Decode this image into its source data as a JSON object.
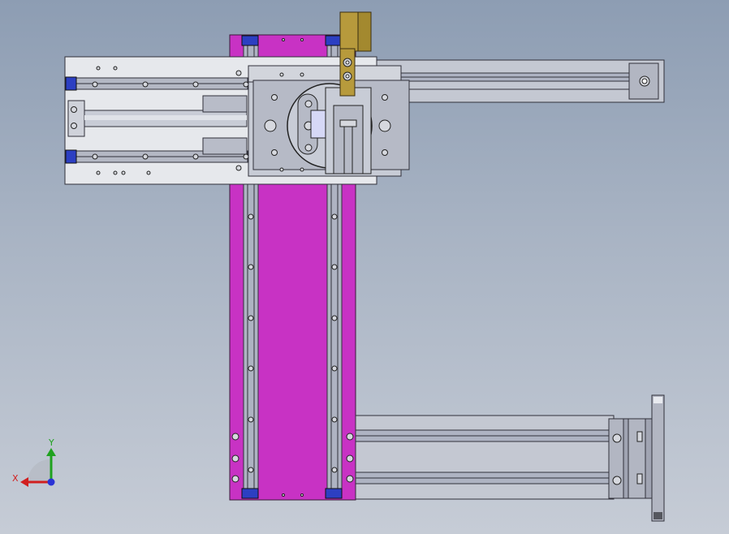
{
  "viewport": {
    "kind": "cad-graphics-area",
    "model": "gantry-slide-assembly",
    "view": "front"
  },
  "colors": {
    "background_top": "#8d9db3",
    "background_bottom": "#c6ccd6",
    "magenta_plate": "#c832c4",
    "rail_grey": "#9ea3b3",
    "frame_light": "#e6e8ec",
    "brass_bar": "#b79a3c",
    "mount_blue": "#2c3fc2",
    "axis_x": "#d11f1f",
    "axis_y": "#1fa21f",
    "axis_z": "#2a33d6"
  },
  "triad": {
    "x_label": "X",
    "y_label": "Y"
  }
}
